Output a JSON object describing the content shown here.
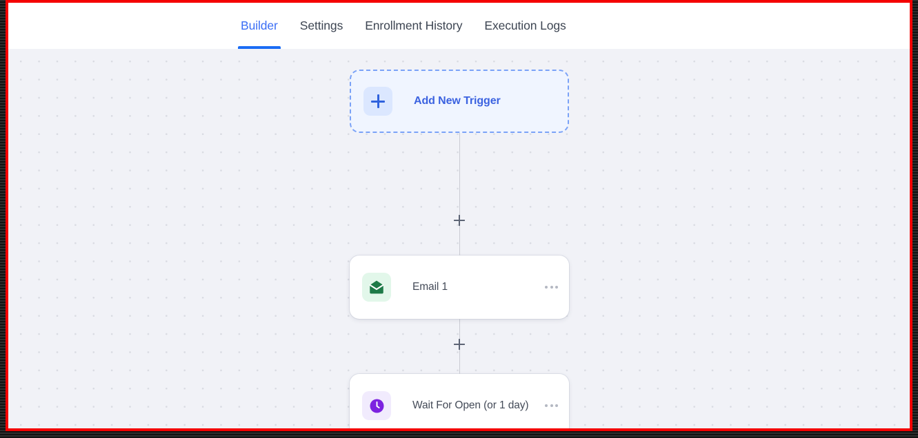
{
  "tabs": [
    {
      "label": "Builder",
      "active": true
    },
    {
      "label": "Settings",
      "active": false
    },
    {
      "label": "Enrollment History",
      "active": false
    },
    {
      "label": "Execution Logs",
      "active": false
    }
  ],
  "canvas": {
    "nodes": [
      {
        "type": "trigger",
        "label": "Add New Trigger",
        "icon": "plus-icon",
        "icon_color": "#2f62dd",
        "tile_color": "#dbe7ff",
        "border_color": "#7aa2f7",
        "background": "#f0f5ff",
        "has_menu": false
      },
      {
        "type": "action",
        "label": "Email 1",
        "icon": "envelope-icon",
        "icon_color": "#1d7a47",
        "tile_color": "#e2f7ea",
        "menu_label": "more-options",
        "has_menu": true
      },
      {
        "type": "delay",
        "label": "Wait For Open (or 1 day)",
        "icon": "clock-icon",
        "icon_color": "#7c22e0",
        "tile_color": "#f1ebfd",
        "menu_label": "more-options",
        "has_menu": true
      }
    ],
    "connectors": [
      {
        "add_label": "+"
      },
      {
        "add_label": "+"
      }
    ],
    "background_color": "#f1f2f7",
    "dot_color": "#d9dbe2"
  },
  "accent_color": "#3b6ef5",
  "frame_color": "#f40000"
}
